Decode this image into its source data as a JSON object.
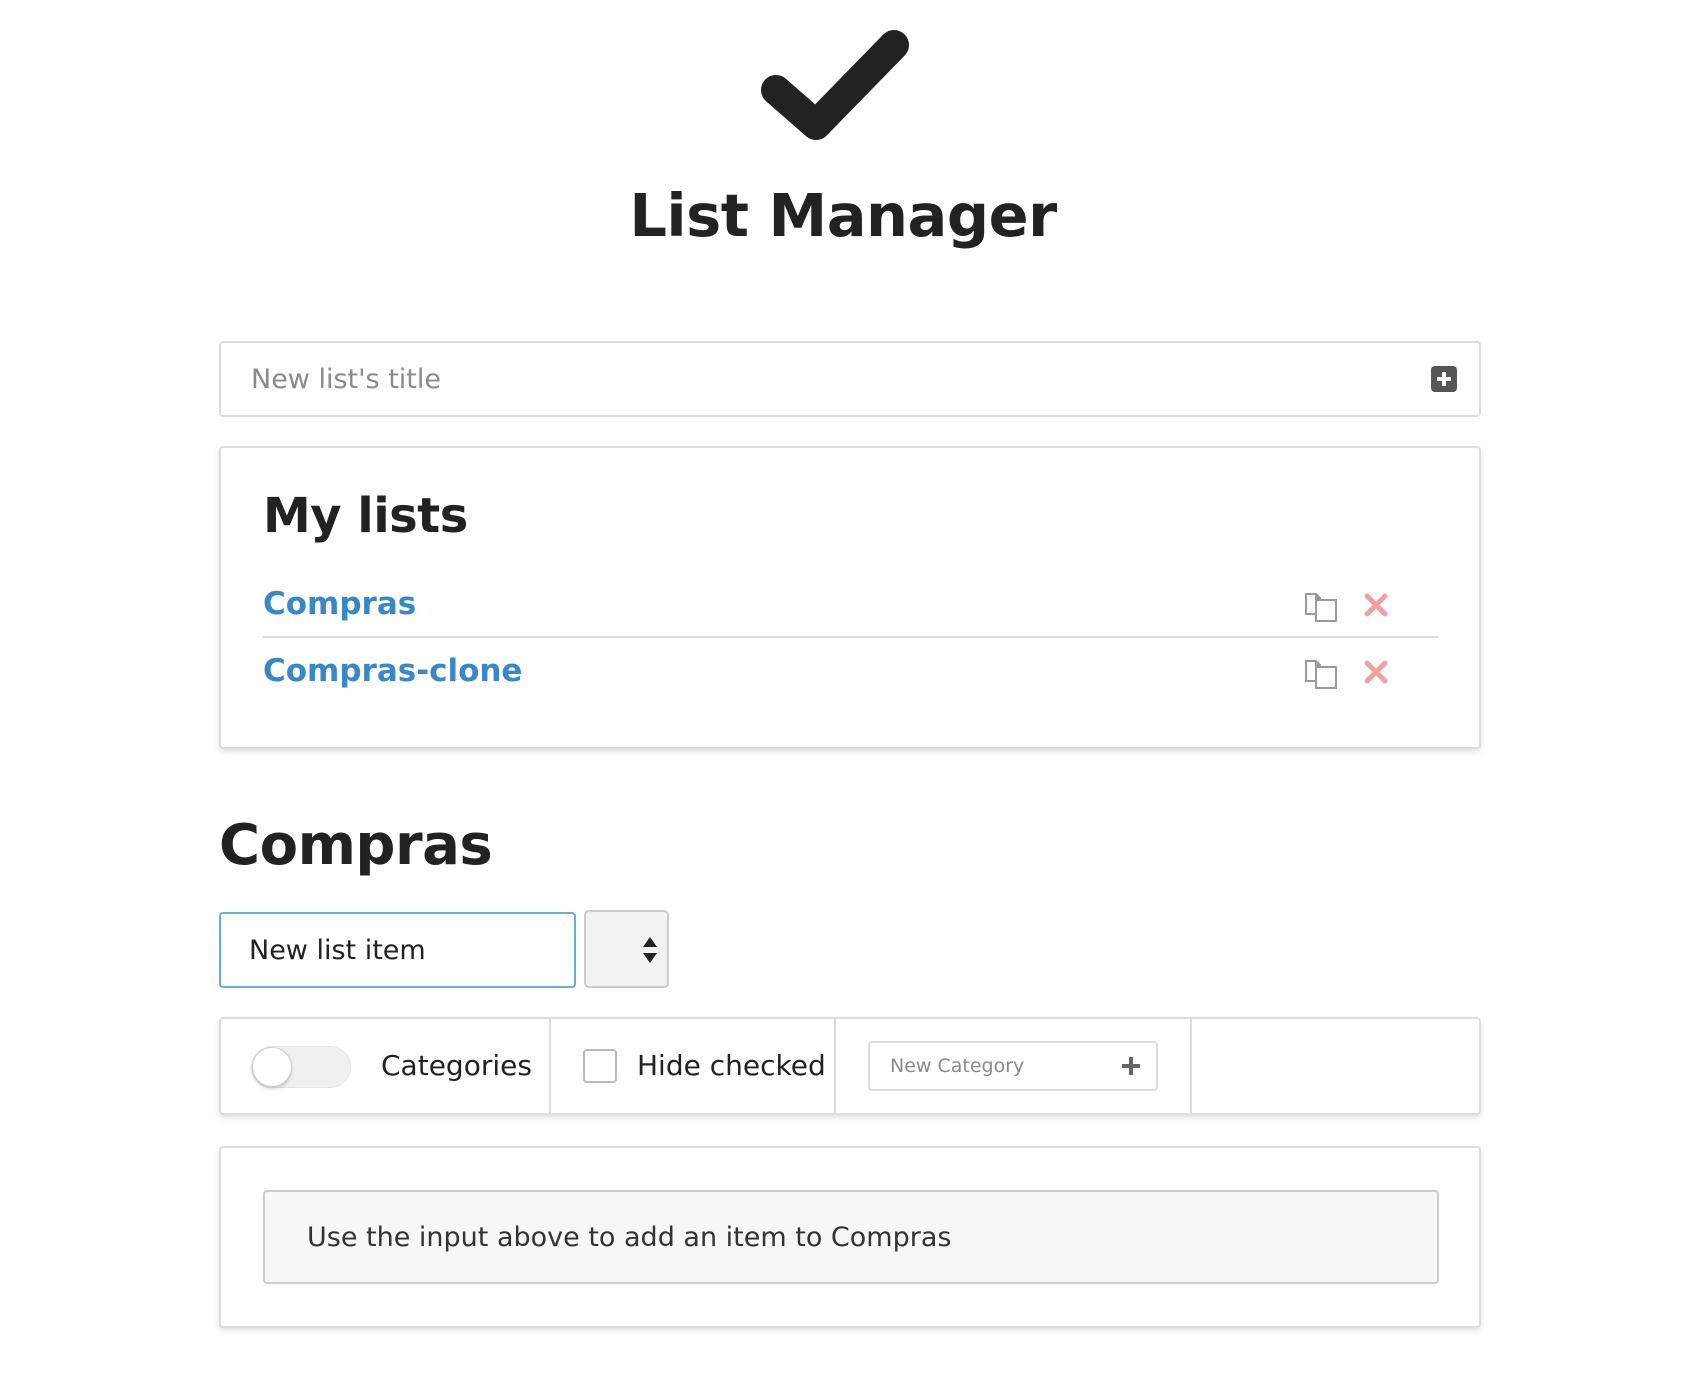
{
  "header": {
    "logo_icon": "checkmark-icon",
    "title": "List Manager"
  },
  "new_list": {
    "placeholder": "New list's title",
    "add_icon": "plus-square-icon"
  },
  "my_lists": {
    "heading": "My lists",
    "items": [
      {
        "label": "Compras",
        "copy_icon": "copy-icon",
        "delete_icon": "delete-x-icon"
      },
      {
        "label": "Compras-clone",
        "copy_icon": "copy-icon",
        "delete_icon": "delete-x-icon"
      }
    ]
  },
  "current_list": {
    "title": "Compras",
    "item_input_placeholder": "New list item",
    "category_select_value": ""
  },
  "controls": {
    "categories_label": "Categories",
    "categories_enabled": false,
    "hide_checked_label": "Hide checked",
    "hide_checked": false,
    "new_category_placeholder": "New Category"
  },
  "items_panel": {
    "empty_message": "Use the input above to add an item to Compras"
  },
  "colors": {
    "link": "#3a87c8",
    "delete": "#f0a0a0",
    "input_focus_border": "#6aaed6",
    "text": "#222222"
  }
}
